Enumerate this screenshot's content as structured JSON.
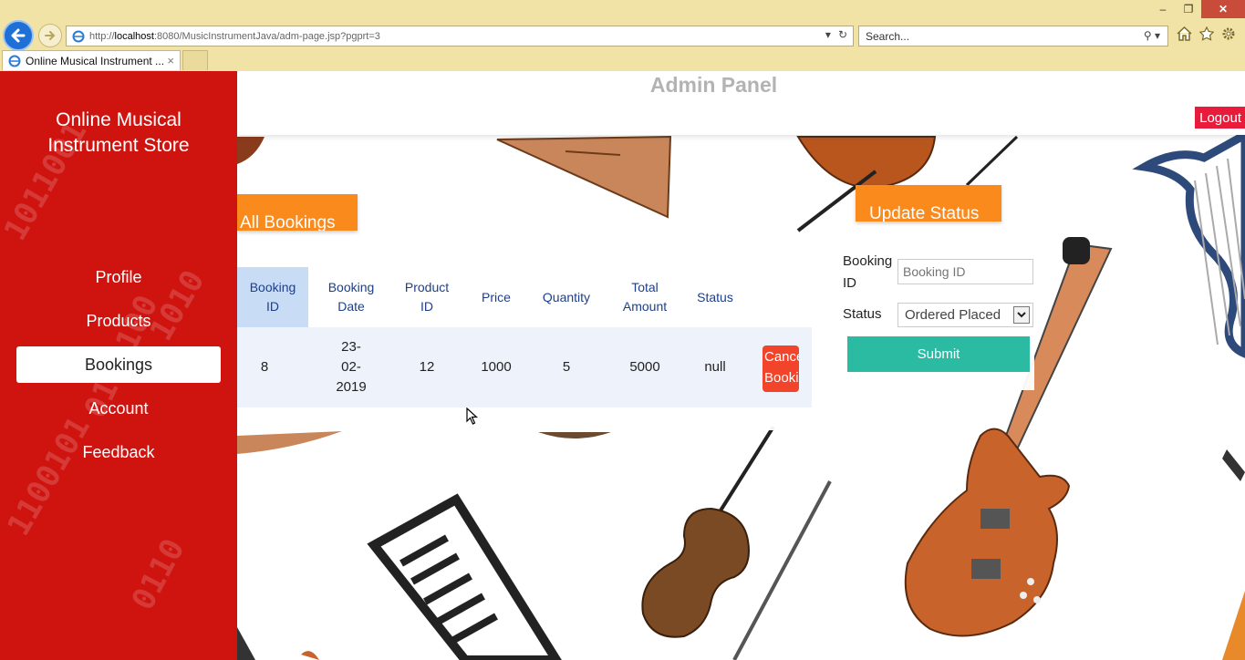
{
  "browser": {
    "url_prefix": "http://",
    "url_host": "localhost",
    "url_rest": ":8080/MusicInstrumentJava/adm-page.jsp?pgprt=3",
    "search_placeholder": "Search...",
    "tab_title": "Online Musical Instrument ...",
    "tab_close": "×",
    "win_min": "–",
    "win_restore": "❐",
    "win_close": "✕"
  },
  "sidebar": {
    "brand_line1": "Online Musical",
    "brand_line2": "Instrument Store",
    "items": [
      {
        "label": "Profile"
      },
      {
        "label": "Products"
      },
      {
        "label": "Bookings"
      },
      {
        "label": "Account"
      },
      {
        "label": "Feedback"
      }
    ],
    "active_index": 2
  },
  "header": {
    "title": "Admin Panel",
    "logout_label": "Logout"
  },
  "bookings": {
    "heading": "All Bookings",
    "columns": [
      {
        "line1": "Booking",
        "line2": "ID"
      },
      {
        "line1": "Booking",
        "line2": "Date"
      },
      {
        "line1": "Product",
        "line2": "ID"
      },
      {
        "line1": "Price",
        "line2": ""
      },
      {
        "line1": "Quantity",
        "line2": ""
      },
      {
        "line1": "Total",
        "line2": "Amount"
      },
      {
        "line1": "Status",
        "line2": ""
      }
    ],
    "rows": [
      {
        "booking_id": "8",
        "date_line1": "23-",
        "date_line2": "02-",
        "date_line3": "2019",
        "product_id": "12",
        "price": "1000",
        "quantity": "5",
        "total_amount": "5000",
        "status": "null",
        "cancel_line1": "Cancel",
        "cancel_line2": "Booking"
      }
    ]
  },
  "update_status": {
    "heading": "Update Status",
    "booking_id_label_line1": "Booking",
    "booking_id_label_line2": "ID",
    "booking_id_placeholder": "Booking ID",
    "status_label": "Status",
    "status_selected": "Ordered Placed",
    "submit_label": "Submit"
  },
  "colors": {
    "sidebar_red": "#cf1410",
    "orange_heading": "#fb8a1c",
    "logout_red": "#e81b3a",
    "submit_teal": "#2bbba3",
    "cancel_red": "#f1442a",
    "header_blue": "#1d3f8a"
  }
}
